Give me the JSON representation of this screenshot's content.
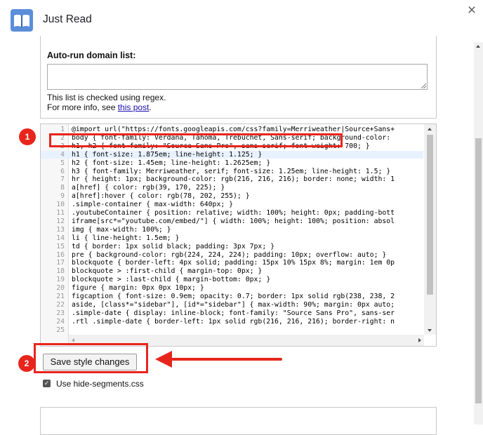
{
  "header": {
    "title": "Just Read",
    "close_symbol": "×"
  },
  "options": {
    "domain_label": "Auto-run domain list:",
    "domain_value": "",
    "note_line1": "This list is checked using regex.",
    "note_line2_prefix": "For more info, see ",
    "note_link": "this post",
    "note_line2_suffix": "."
  },
  "editor": {
    "lines": [
      {
        "n": "1",
        "code": "@import url(\"https://fonts.googleapis.com/css?family=Merriweather|Source+Sans+"
      },
      {
        "n": "2",
        "code": "body { font-family: Verdana, Tahoma, Trebuchet, Sans-serif; background-color:"
      },
      {
        "n": "3",
        "code": "h1, h2 { font-family: \"Source Sans Pro\", sans-serif; font-weight: 700; }"
      },
      {
        "n": "4",
        "code": "h1 { font-size: 1.875em; line-height: 1.125; }"
      },
      {
        "n": "5",
        "code": "h2 { font-size: 1.45em; line-height: 1.2625em; }"
      },
      {
        "n": "6",
        "code": "h3 { font-family: Merriweather, serif; font-size: 1.25em; line-height: 1.5; }"
      },
      {
        "n": "7",
        "code": "hr { height: 1px; background-color: rgb(216, 216, 216); border: none; width: 1"
      },
      {
        "n": "8",
        "code": "a[href] { color: rgb(39, 170, 225); }"
      },
      {
        "n": "9",
        "code": "a[href]:hover { color: rgb(78, 202, 255); }"
      },
      {
        "n": "10",
        "code": ".simple-container { max-width: 640px; }"
      },
      {
        "n": "11",
        "code": ".youtubeContainer { position: relative; width: 100%; height: 0px; padding-bott"
      },
      {
        "n": "12",
        "code": "iframe[src*=\"youtube.com/embed/\"] { width: 100%; height: 100%; position: absol"
      },
      {
        "n": "13",
        "code": "img { max-width: 100%; }"
      },
      {
        "n": "14",
        "code": "li { line-height: 1.5em; }"
      },
      {
        "n": "15",
        "code": "td { border: 1px solid black; padding: 3px 7px; }"
      },
      {
        "n": "16",
        "code": "pre { background-color: rgb(224, 224, 224); padding: 10px; overflow: auto; }"
      },
      {
        "n": "17",
        "code": "blockquote { border-left: 4px solid; padding: 15px 10% 15px 8%; margin: 1em 0p"
      },
      {
        "n": "18",
        "code": "blockquote > :first-child { margin-top: 0px; }"
      },
      {
        "n": "19",
        "code": "blockquote > :last-child { margin-bottom: 0px; }"
      },
      {
        "n": "20",
        "code": "figure { margin: 0px 0px 10px; }"
      },
      {
        "n": "21",
        "code": "figcaption { font-size: 0.9em; opacity: 0.7; border: 1px solid rgb(238, 238, 2"
      },
      {
        "n": "22",
        "code": "aside, [class*=\"sidebar\"], [id*=\"sidebar\"] { max-width: 90%; margin: 0px auto;"
      },
      {
        "n": "23",
        "code": ".simple-date { display: inline-block; font-family: \"Source Sans Pro\", sans-ser"
      },
      {
        "n": "24",
        "code": ".rtl .simple-date { border-left: 1px solid rgb(216, 216, 216); border-right: n"
      },
      {
        "n": "25",
        "code": ""
      }
    ],
    "active_line": 4
  },
  "annotations": {
    "badge1": "1",
    "badge2": "2",
    "color": "#e8251c"
  },
  "save_button": "Save style changes",
  "checkbox": {
    "label": "Use hide-segments.css",
    "checked": true
  },
  "icons": {
    "app": "open-book-icon",
    "close": "close-icon",
    "check": "checkmark-icon",
    "arrow": "red-arrow-icon"
  }
}
